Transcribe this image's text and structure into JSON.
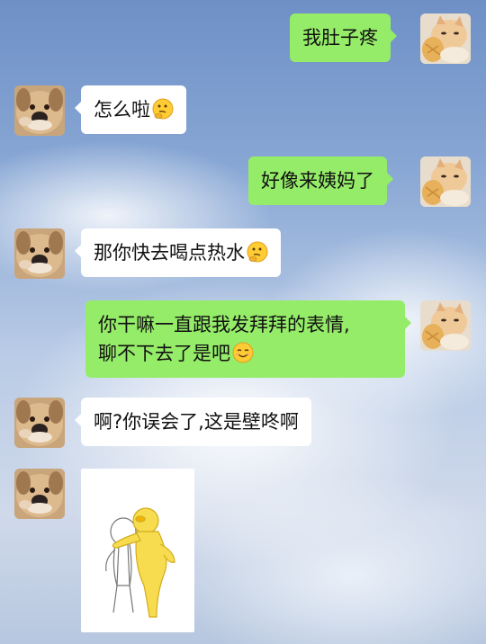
{
  "messages": [
    {
      "side": "right",
      "text": "我肚子疼"
    },
    {
      "side": "left",
      "text": "怎么啦",
      "emoji": "thinking-face-icon"
    },
    {
      "side": "right",
      "text": "好像来姨妈了"
    },
    {
      "side": "left",
      "text": "那你快去喝点热水",
      "emoji": "thinking-face-icon"
    },
    {
      "side": "right",
      "lines": [
        "你干嘛一直跟我发拜拜的表情,",
        "聊不下去了是吧"
      ],
      "emoji": "smiling-face-icon"
    },
    {
      "side": "left",
      "text": "啊?你误会了,这是壁咚啊"
    },
    {
      "side": "left",
      "type": "sticker",
      "sticker": "wall-slam-sticker-icon"
    }
  ],
  "avatars": {
    "left": "dog-avatar-icon",
    "right": "cat-avatar-icon"
  },
  "colors": {
    "right_bubble": "#95ec69",
    "left_bubble": "#ffffff"
  }
}
